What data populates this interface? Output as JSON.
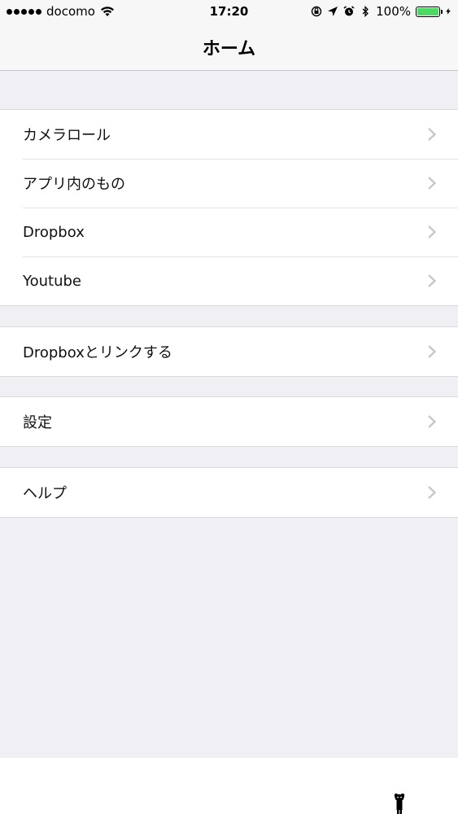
{
  "status_bar": {
    "carrier": "docomo",
    "time": "17:20",
    "battery": "100%",
    "battery_level": 1.0,
    "signal_bars": 5
  },
  "nav": {
    "title": "ホーム"
  },
  "menu": {
    "group1": [
      {
        "label": "カメラロール"
      },
      {
        "label": "アプリ内のもの"
      },
      {
        "label": "Dropbox"
      },
      {
        "label": "Youtube"
      }
    ],
    "group2": [
      {
        "label": "Dropboxとリンクする"
      }
    ],
    "group3": [
      {
        "label": "設定"
      }
    ],
    "group4": [
      {
        "label": "ヘルプ"
      }
    ]
  },
  "colors": {
    "background": "#efeff4",
    "battery_fill": "#4cd964",
    "chevron": "#c7c7cc"
  }
}
